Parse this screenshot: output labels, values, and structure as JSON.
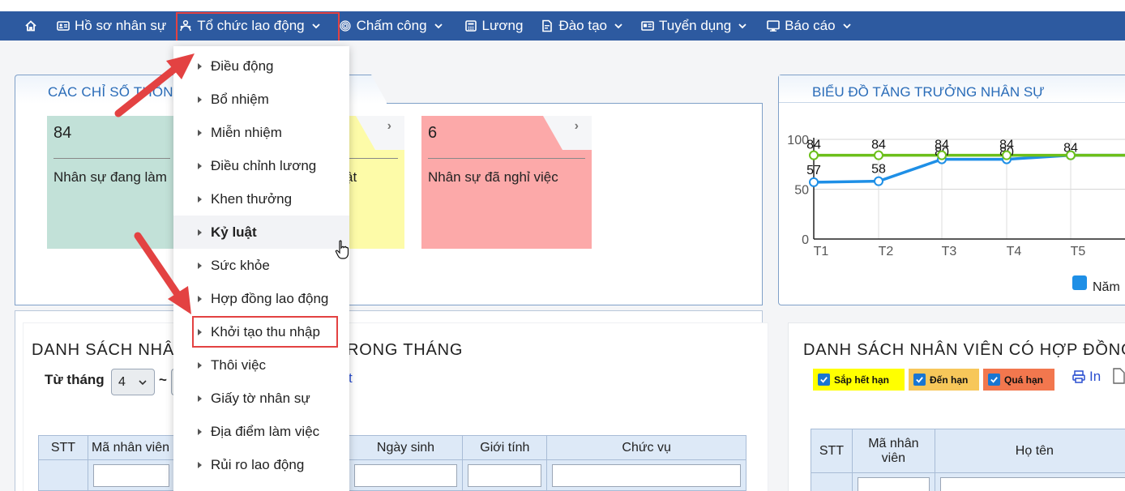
{
  "nav": {
    "items": [
      {
        "label": "Hồ sơ nhân sự",
        "icon": "id-card-icon",
        "has_chevron": false
      },
      {
        "label": "Tổ chức lao động",
        "icon": "org-icon",
        "has_chevron": true
      },
      {
        "label": "Chấm công",
        "icon": "fingerprint-icon",
        "has_chevron": true
      },
      {
        "label": "Lương",
        "icon": "calculator-icon",
        "has_chevron": false
      },
      {
        "label": "Đào tạo",
        "icon": "training-icon",
        "has_chevron": true
      },
      {
        "label": "Tuyển dụng",
        "icon": "recruit-icon",
        "has_chevron": true
      },
      {
        "label": "Báo cáo",
        "icon": "monitor-icon",
        "has_chevron": true
      }
    ]
  },
  "dropdown": {
    "items": [
      "Điều động",
      "Bổ nhiệm",
      "Miễn nhiệm",
      "Điều chỉnh lương",
      "Khen thưởng",
      "Kỷ luật",
      "Sức khỏe",
      "Hợp đồng lao động",
      "Khởi tạo thu nhập",
      "Thôi việc",
      "Giấy tờ nhân sự",
      "Địa điểm làm việc",
      "Rủi ro lao động"
    ],
    "hovered": "Kỷ luật",
    "highlighted": "Khởi tạo thu nhập"
  },
  "indicators": {
    "title": "CÁC CHỈ SỐ THỐNG",
    "cards": [
      {
        "value": "84",
        "label": "Nhân sự đang làm",
        "color": "#c2e1d8"
      },
      {
        "value": "",
        "label": "ật",
        "color": "#fdfba8"
      },
      {
        "value": "6",
        "label": "Nhân sự đã nghỉ việc",
        "color": "#fca9a9"
      }
    ]
  },
  "growth_chart": {
    "title": "BIỂU ĐỒ TĂNG TRƯỞNG NHÂN SỰ",
    "legend_label": "Năm"
  },
  "chart_data": {
    "type": "line",
    "x": [
      "T1",
      "T2",
      "T3",
      "T4",
      "T5"
    ],
    "yticks": [
      0,
      50,
      100
    ],
    "ylim": [
      0,
      100
    ],
    "series": [
      {
        "values": [
          57,
          58,
          80,
          80,
          84
        ],
        "color": "#1e8fe6",
        "labels": [
          "57",
          "58",
          "80",
          "80",
          "84"
        ]
      },
      {
        "values": [
          84,
          84,
          84,
          84,
          84
        ],
        "color": "#6cbf1a",
        "labels": [
          "84",
          "84",
          "84",
          "84",
          ""
        ]
      }
    ]
  },
  "list_left": {
    "title_start": "DANH SÁCH NHÂ",
    "title_end": "RONG THÁNG",
    "from_label": "Từ tháng",
    "from_month": "4",
    "tilde": "~",
    "stray_text": "t",
    "columns": [
      "STT",
      "Mã nhân viên",
      "Ngày sinh",
      "Giới tính",
      "Chức vụ"
    ]
  },
  "list_right": {
    "title": "DANH SÁCH NHÂN VIÊN CÓ HỢP ĐỒNG",
    "filters": [
      {
        "label": "Sắp hết hạn",
        "color": "#ffff00"
      },
      {
        "label": "Đến hạn",
        "color": "#f7c75a"
      },
      {
        "label": "Quá hạn",
        "color": "#f2774e"
      }
    ],
    "print_label": "In",
    "columns": [
      "STT",
      "Mã nhân viên",
      "Họ tên"
    ]
  }
}
